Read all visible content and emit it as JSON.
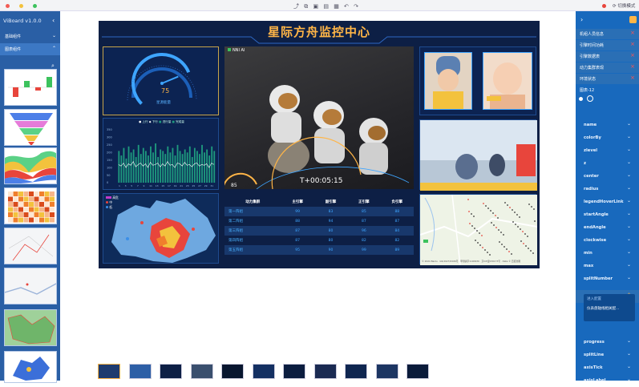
{
  "app": {
    "title": "ViBoard v1.0.0",
    "mode_switch_label": "切换模式"
  },
  "left_panel": {
    "sections": [
      {
        "label": "基础组件"
      },
      {
        "label": "图表组件"
      }
    ],
    "thumbnails": [
      "bar-chart-thumb",
      "funnel-thumb",
      "stream-thumb",
      "heatmap-thumb",
      "map-thumb",
      "map-thumb-2",
      "map-thumb-3",
      "map-thumb-4"
    ]
  },
  "dashboard": {
    "title": "星际方舟监控中心",
    "gauge": {
      "value": "75",
      "label": "星源能量",
      "level": 0.75
    },
    "video": {
      "label": "NNI AI",
      "timer": "T+00:05:15",
      "speed": "85"
    },
    "bar_chart": {
      "legend": [
        "上行",
        "下行",
        "进行量",
        "完成量"
      ],
      "y_ticks": [
        "350",
        "300",
        "250",
        "200",
        "150",
        "100",
        "50",
        "0"
      ],
      "x_ticks": [
        "1",
        "3",
        "5",
        "7",
        "9",
        "11",
        "13",
        "15",
        "17",
        "19",
        "21",
        "23",
        "25",
        "27",
        "29",
        "31"
      ]
    },
    "map_legend": [
      {
        "label": "高危",
        "color": "#c43bc8"
      },
      {
        "label": "中",
        "color": "#e8453c"
      },
      {
        "label": "低",
        "color": "#3b8fe8"
      }
    ],
    "power_table": {
      "headers": [
        "动力集群",
        "主引擎",
        "副引擎",
        "正引擎",
        "负引擎"
      ],
      "rows": [
        [
          "第一阵组",
          "99",
          "83",
          "85",
          "88"
        ],
        [
          "第二阵组",
          "88",
          "94",
          "87",
          "87"
        ],
        [
          "第三阵组",
          "87",
          "80",
          "96",
          "84"
        ],
        [
          "第四阵组",
          "87",
          "80",
          "82",
          "82"
        ],
        [
          "第五阵组",
          "95",
          "90",
          "99",
          "89"
        ]
      ]
    },
    "map_copyright": "© 2024 Baidu · GS(2023)3206号 · 甲测资字1100930 · 京ICP证030173号 · Data © 百度智图"
  },
  "right_panel": {
    "tabs": [
      "机组人员信息",
      "引擎时间功耗",
      "引擎数据表",
      "动力集群表现",
      "环境状态"
    ],
    "chart_label": "图表-12",
    "props": [
      "name",
      "colorBy",
      "zlevel",
      "z",
      "center",
      "radius",
      "legendHoverLink",
      "startAngle",
      "endAngle",
      "clockwise",
      "min",
      "max",
      "splitNumber",
      "axisLine",
      "progress",
      "splitLine",
      "axisTick",
      "axisLabel"
    ],
    "axisline_popup": {
      "title": "进入配置",
      "text": "仪表盘轴线相关配..."
    }
  },
  "colors": {
    "accent": "#ffb547",
    "panel_bg": "#0d1f45",
    "sidebar": "#2a5fa5",
    "rightbar": "#1869bd"
  },
  "bar_values": [
    210,
    180,
    230,
    160,
    240,
    200,
    220,
    170,
    250,
    190,
    230,
    210,
    180,
    240,
    200,
    260,
    170,
    220,
    210,
    190,
    240,
    200,
    230,
    180,
    250,
    210,
    190,
    220,
    200,
    240,
    170,
    230,
    210,
    190,
    250,
    200,
    220,
    180,
    240,
    210
  ],
  "line_values": [
    120,
    110,
    130,
    100,
    125,
    115,
    140,
    105,
    120,
    130,
    110,
    125,
    100,
    135,
    115,
    120,
    130,
    105,
    125,
    110,
    140,
    115,
    120,
    100,
    130,
    125,
    110,
    135,
    115,
    120,
    105,
    125,
    130,
    110,
    120,
    115,
    125,
    100,
    130,
    120
  ]
}
